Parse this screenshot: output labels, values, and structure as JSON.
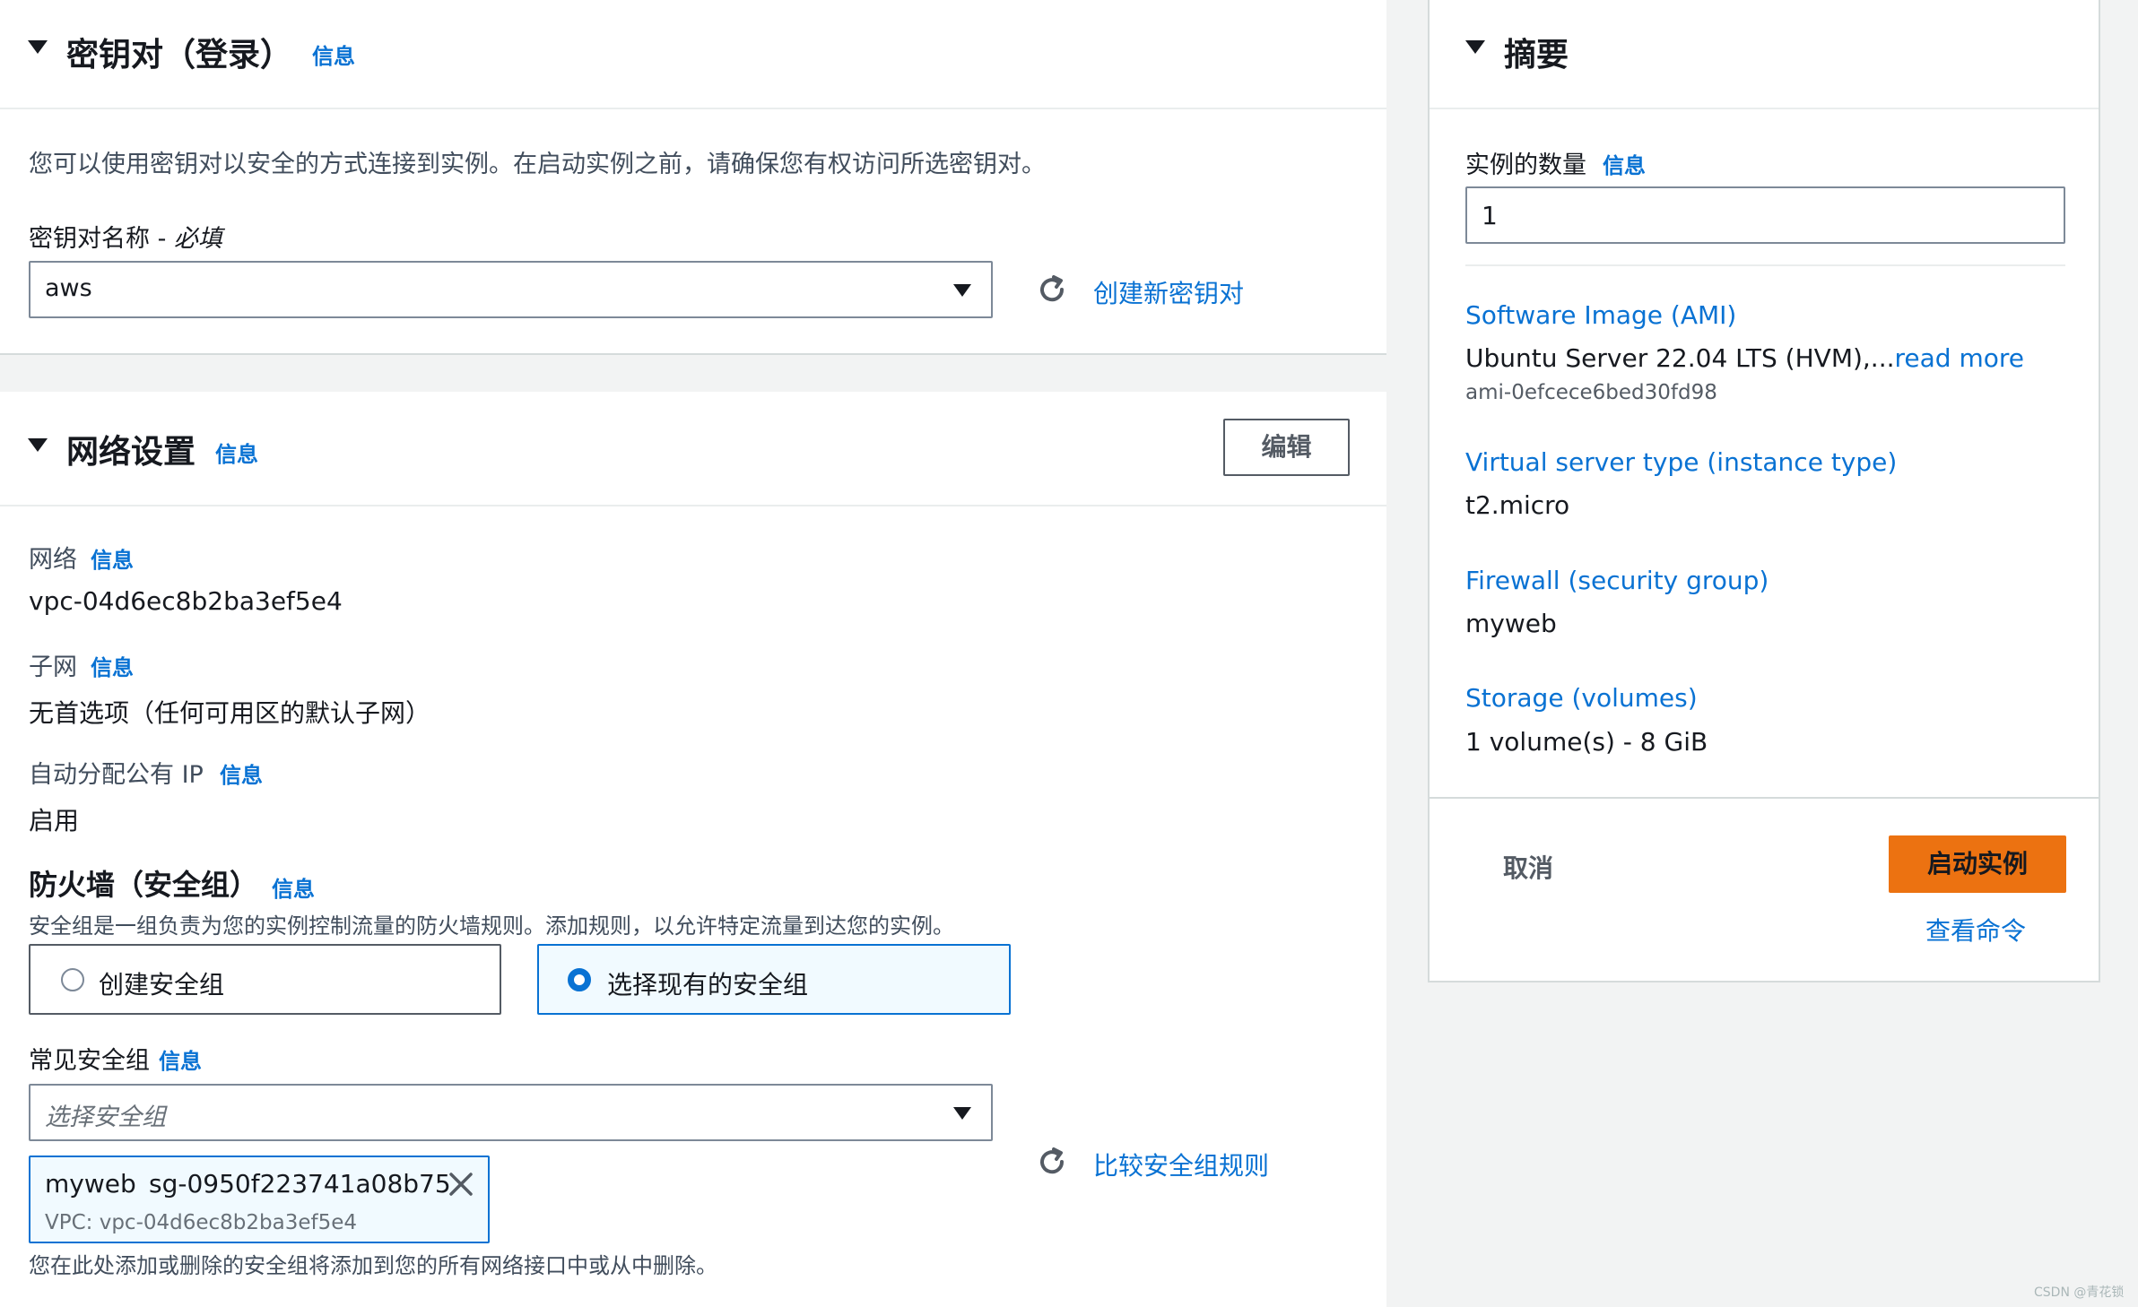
{
  "key_pair_section": {
    "title": "密钥对（登录）",
    "info": "信息",
    "description": "您可以使用密钥对以安全的方式连接到实例。在启动实例之前，请确保您有权访问所选密钥对。",
    "field_label": "密钥对名称 - ",
    "field_required": "必填",
    "selected_value": "aws",
    "create_link": "创建新密钥对"
  },
  "network_section": {
    "title": "网络设置",
    "info": "信息",
    "edit_button": "编辑",
    "network_label": "网络",
    "network_info": "信息",
    "network_value": "vpc-04d6ec8b2ba3ef5e4",
    "subnet_label": "子网",
    "subnet_info": "信息",
    "subnet_value": "无首选项（任何可用区的默认子网）",
    "public_ip_label": "自动分配公有 IP",
    "public_ip_info": "信息",
    "public_ip_value": "启用",
    "firewall_title": "防火墙（安全组）",
    "firewall_info": "信息",
    "firewall_description": "安全组是一组负责为您的实例控制流量的防火墙规则。添加规则，以允许特定流量到达您的实例。",
    "option_create": "创建安全组",
    "option_existing": "选择现有的安全组",
    "selected_option": "existing",
    "common_sg_label": "常见安全组",
    "common_sg_info": "信息",
    "sg_placeholder": "选择安全组",
    "compare_link": "比较安全组规则",
    "token_name": "myweb",
    "token_id": "sg-0950f223741a08b75",
    "token_vpc": "VPC: vpc-04d6ec8b2ba3ef5e4",
    "footer_note": "您在此处添加或删除的安全组将添加到您的所有网络接口中或从中删除。"
  },
  "summary": {
    "title": "摘要",
    "instances_label": "实例的数量",
    "instances_info": "信息",
    "instances_value": "1",
    "ami_title": "Software Image (AMI)",
    "ami_value": "Ubuntu Server 22.04 LTS (HVM),...",
    "ami_read_more": "read more",
    "ami_id": "ami-0efcece6bed30fd98",
    "instance_type_title": "Virtual server type (instance type)",
    "instance_type_value": "t2.micro",
    "firewall_title": "Firewall (security group)",
    "firewall_value": "myweb",
    "storage_title": "Storage (volumes)",
    "storage_value": "1 volume(s) - 8 GiB",
    "cancel": "取消",
    "launch": "启动实例",
    "view_command": "查看命令"
  },
  "watermark": "CSDN @青花锁",
  "colors": {
    "link": "#0972d3",
    "primary_button": "#ec7211",
    "background": "#f2f3f3",
    "panel": "#ffffff"
  }
}
